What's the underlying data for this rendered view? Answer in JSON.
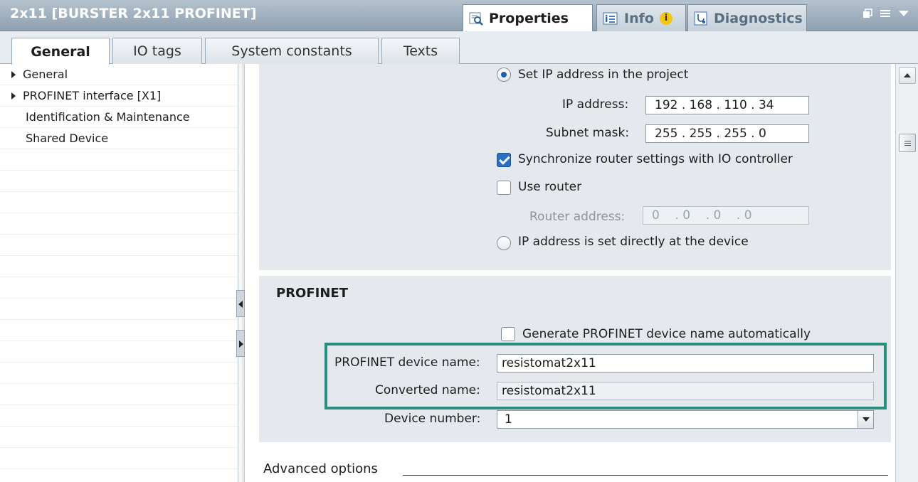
{
  "title": "2x11 [BURSTER 2x11 PROFINET]",
  "right_tabs": [
    {
      "label": "Properties",
      "icon": "properties-icon",
      "active": true
    },
    {
      "label": "Info",
      "icon": "info-icon",
      "badge": "i"
    },
    {
      "label": "Diagnostics",
      "icon": "diagnostics-icon"
    }
  ],
  "sub_tabs": [
    "General",
    "IO tags",
    "System constants",
    "Texts"
  ],
  "tree": [
    {
      "label": "General",
      "expandable": true
    },
    {
      "label": "PROFINET interface [X1]",
      "expandable": true
    },
    {
      "label": "Identification & Maintenance",
      "expandable": false
    },
    {
      "label": "Shared Device",
      "expandable": false
    }
  ],
  "ip_section": {
    "set_ip_label": "Set IP address in the project",
    "ip_label": "IP address:",
    "ip_value": "192 . 168 . 110 . 34",
    "subnet_label": "Subnet mask:",
    "subnet_value": "255 . 255 . 255 . 0",
    "sync_label": "Synchronize router settings with IO controller",
    "sync_checked": true,
    "use_router_label": "Use router",
    "use_router_checked": false,
    "router_label": "Router address:",
    "router_value": "0    . 0    . 0    . 0",
    "direct_label": "IP address is set directly at the device"
  },
  "profinet": {
    "heading": "PROFINET",
    "auto_name_label": "Generate PROFINET device name automatically",
    "auto_name_checked": false,
    "device_name_label": "PROFINET device name:",
    "device_name_value": "resistomat2x11",
    "converted_label": "Converted name:",
    "converted_value": "resistomat2x11",
    "device_number_label": "Device number:",
    "device_number_value": "1",
    "highlight_color": "#2a8d80"
  },
  "advanced_label": "Advanced options",
  "colors": {
    "accent": "#2a6fc1",
    "section_bg": "#e5e9ee"
  }
}
